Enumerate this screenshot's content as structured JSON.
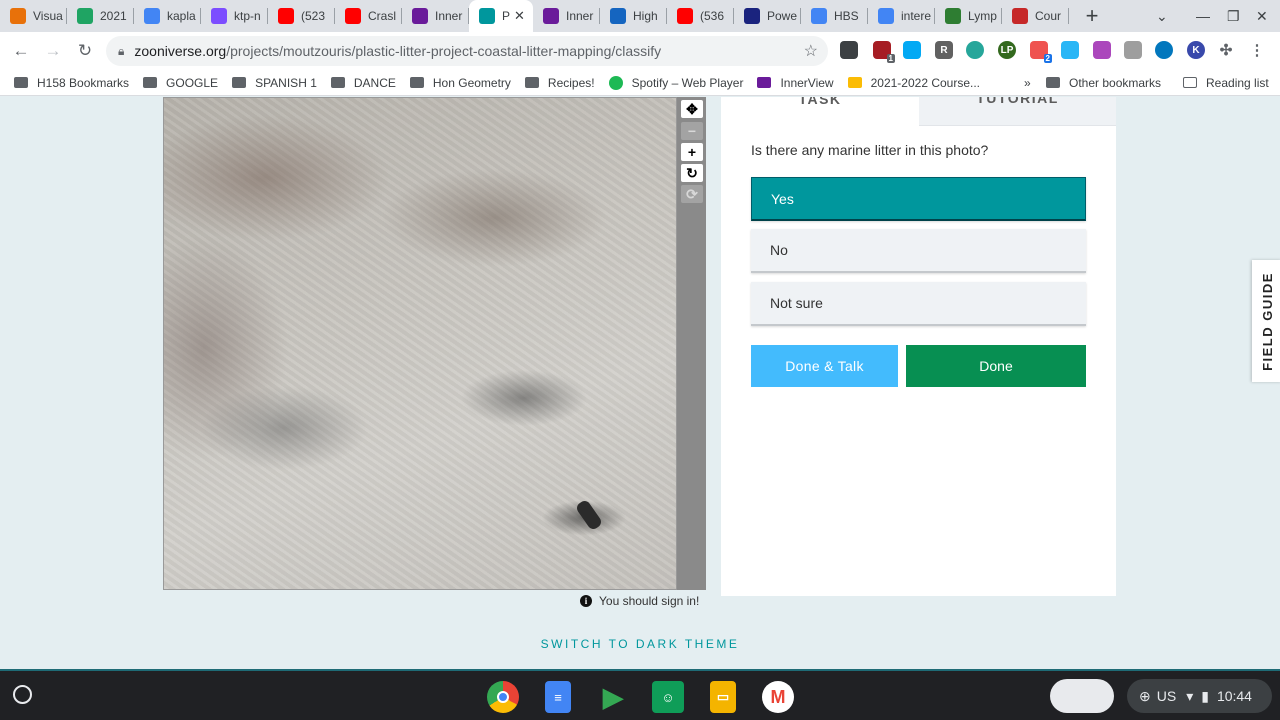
{
  "tabs": [
    {
      "title": "Visua",
      "icon": "Z",
      "color": "#e8710a"
    },
    {
      "title": "2021",
      "icon": "drive",
      "color": "#1fa463"
    },
    {
      "title": "kapla",
      "icon": "G",
      "color": "#4285f4"
    },
    {
      "title": "ktp-n",
      "icon": "K",
      "color": "#7c4dff"
    },
    {
      "title": "(523",
      "icon": "yt",
      "color": "#ff0000"
    },
    {
      "title": "Crasl",
      "icon": "yt",
      "color": "#ff0000"
    },
    {
      "title": "Inner",
      "icon": "iv",
      "color": "#6a1b9a"
    },
    {
      "title": "P",
      "icon": "zoo",
      "color": "#00979d",
      "active": true
    },
    {
      "title": "Inner",
      "icon": "iv",
      "color": "#6a1b9a"
    },
    {
      "title": "High",
      "icon": "S",
      "color": "#1565c0"
    },
    {
      "title": "(536",
      "icon": "yt",
      "color": "#ff0000"
    },
    {
      "title": "Powe",
      "icon": "P",
      "color": "#1a237e"
    },
    {
      "title": "HBS",
      "icon": "docs",
      "color": "#4285f4"
    },
    {
      "title": "intere",
      "icon": "G",
      "color": "#4285f4"
    },
    {
      "title": "Lymp",
      "icon": "+",
      "color": "#2e7d32"
    },
    {
      "title": "Cour",
      "icon": "M",
      "color": "#c62828"
    }
  ],
  "active_tab_close": "✕",
  "new_tab": "+",
  "address": {
    "domain": "zooniverse.org",
    "path": "/projects/moutzouris/plastic-litter-project-coastal-litter-mapping/classify"
  },
  "bookmarks": [
    {
      "label": "H158 Bookmarks",
      "type": "special"
    },
    {
      "label": "GOOGLE",
      "type": "folder"
    },
    {
      "label": "SPANISH 1",
      "type": "folder"
    },
    {
      "label": "DANCE",
      "type": "folder"
    },
    {
      "label": "Hon Geometry",
      "type": "folder"
    },
    {
      "label": "Recipes!",
      "type": "folder"
    },
    {
      "label": "Spotify – Web Player",
      "type": "spotify"
    },
    {
      "label": "InnerView",
      "type": "innerview"
    },
    {
      "label": "2021-2022 Course...",
      "type": "drive"
    }
  ],
  "bookmarks_overflow": "»",
  "other_bookmarks": "Other bookmarks",
  "reading_list": "Reading list",
  "extension_badges": [
    "1",
    "2"
  ],
  "extension_letters": {
    "r": "R",
    "lp": "LP",
    "k": "K"
  },
  "task_panel": {
    "tab_task": "TASK",
    "tab_tutorial": "TUTORIAL",
    "question": "Is there any marine litter in this photo?",
    "answers": [
      {
        "label": "Yes",
        "selected": true
      },
      {
        "label": "No",
        "selected": false
      },
      {
        "label": "Not sure",
        "selected": false
      }
    ],
    "done_talk": "Done & Talk",
    "done": "Done"
  },
  "sign_in_note": "You should sign in!",
  "info_glyph": "i",
  "dark_theme_link": "SWITCH TO DARK THEME",
  "field_guide": "FIELD GUIDE",
  "shelf": {
    "apps": [
      "Chrome",
      "Docs",
      "Play Store",
      "Classroom",
      "Slides",
      "Gmail"
    ],
    "locale": "US",
    "time": "10:44"
  }
}
